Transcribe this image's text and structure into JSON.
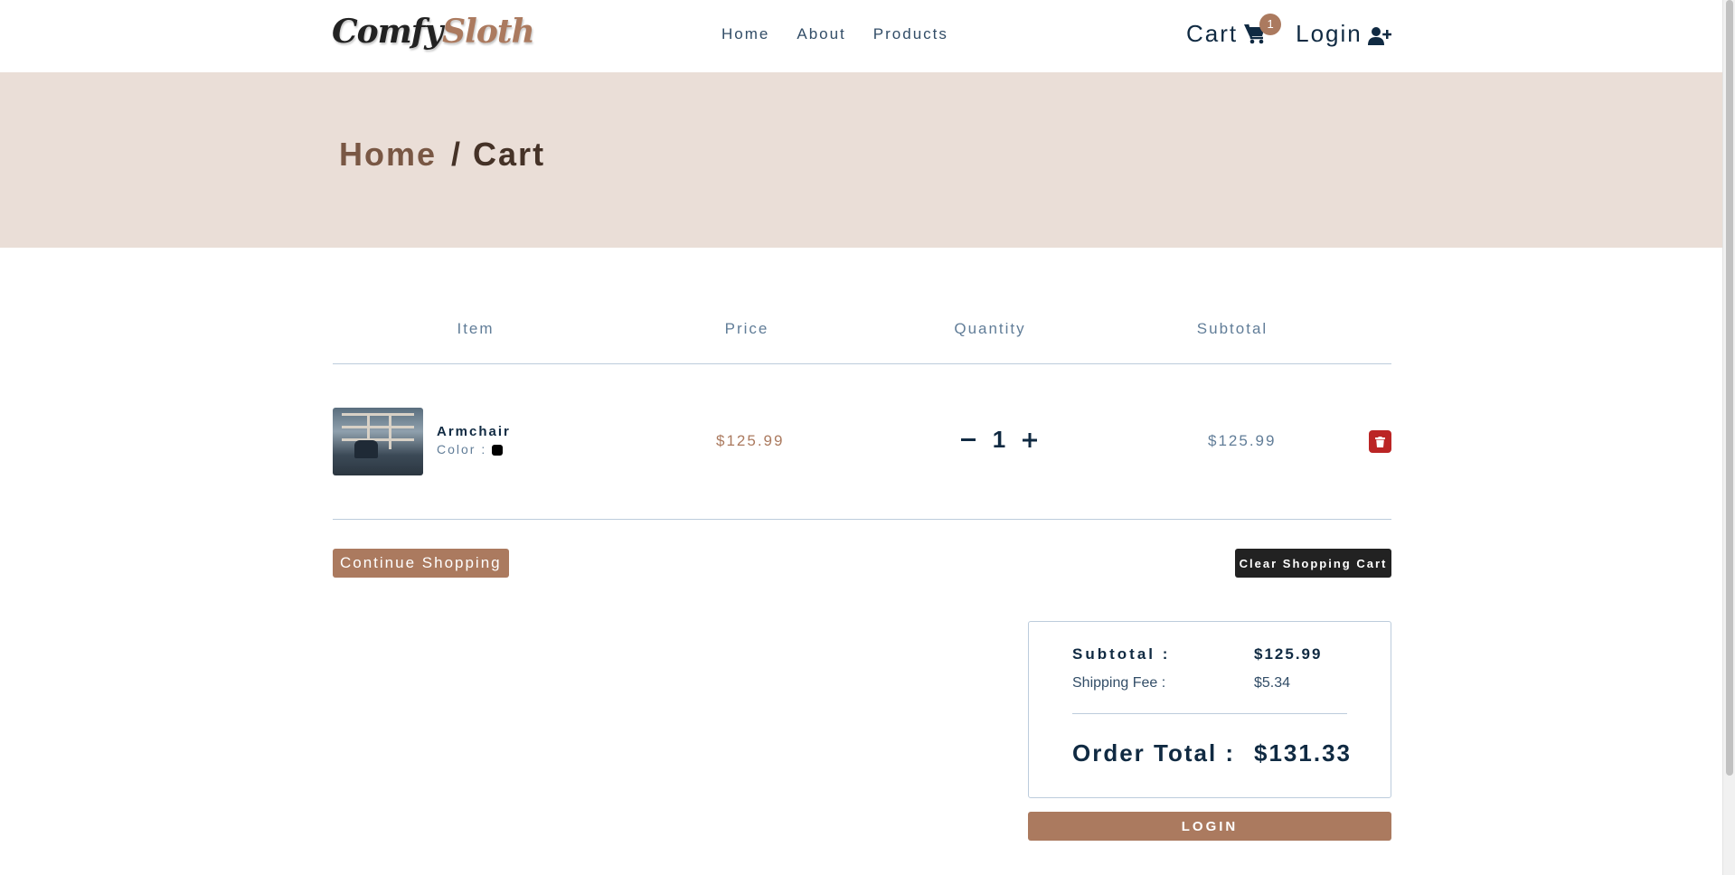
{
  "navbar": {
    "logo_part1": "Comfy",
    "logo_part2": "Sloth",
    "links": [
      "Home",
      "About",
      "Products"
    ],
    "cart_label": "Cart",
    "cart_count": "1",
    "login_label": "Login"
  },
  "hero": {
    "breadcrumb_home": "Home",
    "breadcrumb_current": "/ Cart"
  },
  "cart_table": {
    "columns": [
      "Item",
      "Price",
      "Quantity",
      "Subtotal"
    ],
    "items": [
      {
        "name": "Armchair",
        "color_label": "Color :",
        "color": "#000000",
        "price": "$125.99",
        "quantity": "1",
        "subtotal": "$125.99"
      }
    ]
  },
  "actions": {
    "continue_label": "Continue Shopping",
    "clear_label": "Clear Shopping Cart"
  },
  "totals": {
    "subtotal_label": "Subtotal :",
    "subtotal_value": "$125.99",
    "shipping_label": "Shipping Fee :",
    "shipping_value": "$5.34",
    "order_total_label": "Order Total :",
    "order_total_value": "$131.33",
    "checkout_label": "LOGIN"
  },
  "colors": {
    "brand": "#ab7a5f",
    "hero_bg": "#eaded7",
    "dark": "#102a42",
    "danger": "#bb2525"
  }
}
